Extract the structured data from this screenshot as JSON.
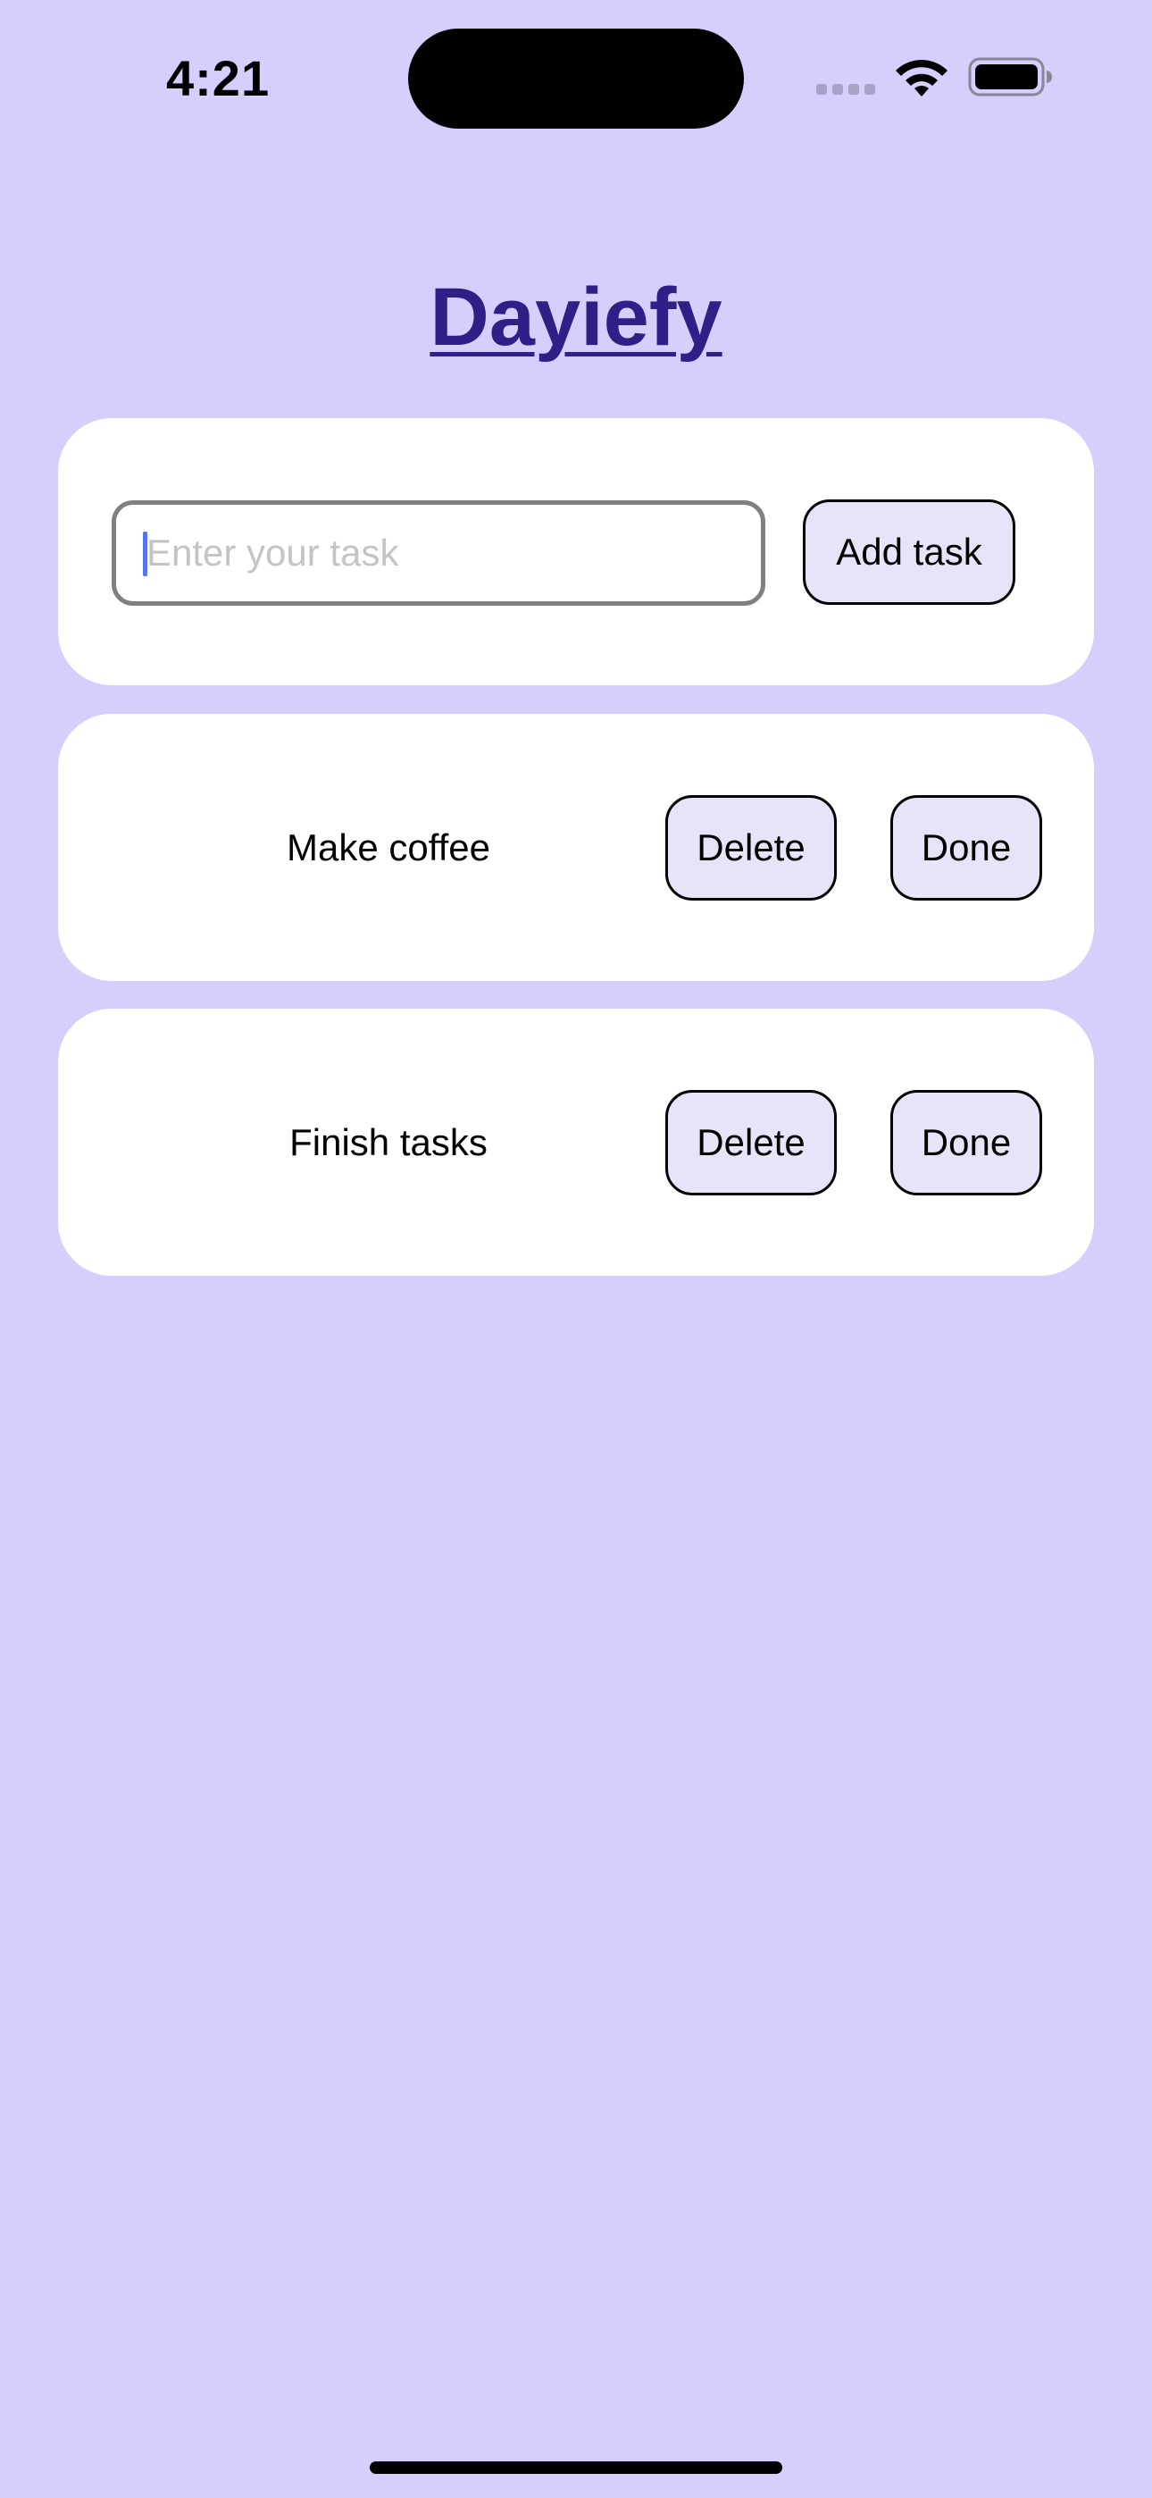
{
  "status_bar": {
    "time": "4:21",
    "icons": [
      "signal-icon",
      "wifi-icon",
      "battery-icon"
    ]
  },
  "app": {
    "title": "Dayiefy"
  },
  "task_input": {
    "value": "",
    "placeholder": "Enter your task",
    "add_label": "Add task"
  },
  "tasks": [
    {
      "label": "Make coffee",
      "delete_label": "Delete",
      "done_label": "Done"
    },
    {
      "label": "Finish tasks",
      "delete_label": "Delete",
      "done_label": "Done"
    }
  ],
  "colors": {
    "background": "#d6cffe",
    "card": "#ffffff",
    "title": "#2f1f86",
    "button": "#e6e4f8",
    "caret": "#5873ef",
    "placeholder": "#c4c4c6"
  }
}
